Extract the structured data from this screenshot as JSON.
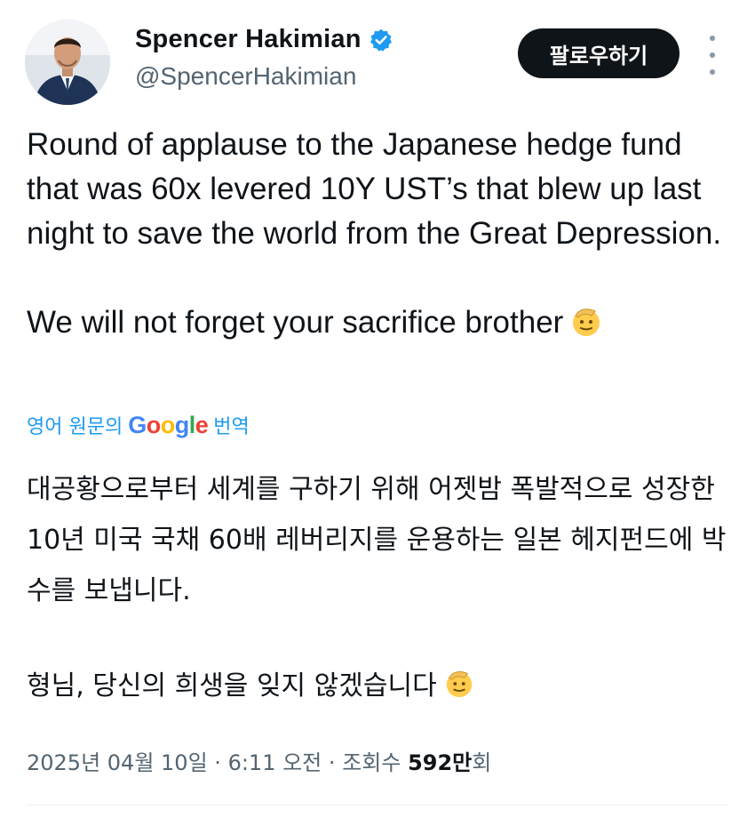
{
  "author": {
    "display_name": "Spencer Hakimian",
    "handle": "@SpencerHakimian",
    "verified_icon": "verified-badge-icon",
    "avatar_icon": "avatar"
  },
  "actions": {
    "follow_label": "팔로우하기",
    "more_icon": "more-vertical-icon"
  },
  "tweet": {
    "text_en_p1": "Round of applause to the Japanese hedge fund that was 60x levered 10Y UST’s that blew up last night to save the world from the Great Depression.",
    "text_en_p2": "We will not forget your sacrifice brother",
    "emoji_name": "saluting-face-emoji",
    "translate_prefix": "영어 원문의",
    "translate_brand": "Google",
    "translate_suffix": "번역",
    "text_ko_p1": "대공황으로부터 세계를 구하기 위해 어젯밤 폭발적으로 성장한 10년 미국 국채 60배 레버리지를 운용하는 일본 헤지펀드에 박수를 보냅니다.",
    "text_ko_p2": "형님, 당신의 희생을 잊지 않겠습니다"
  },
  "meta": {
    "date": "2025년 04월 10일",
    "time": "6:11 오전",
    "views_label": "조회수",
    "views_count": "592만",
    "views_suffix": "회",
    "separator": "·"
  },
  "colors": {
    "accent_blue": "#1d9bf0",
    "text_primary": "#0f1419",
    "text_secondary": "#536471",
    "follow_bg": "#0f1419"
  }
}
